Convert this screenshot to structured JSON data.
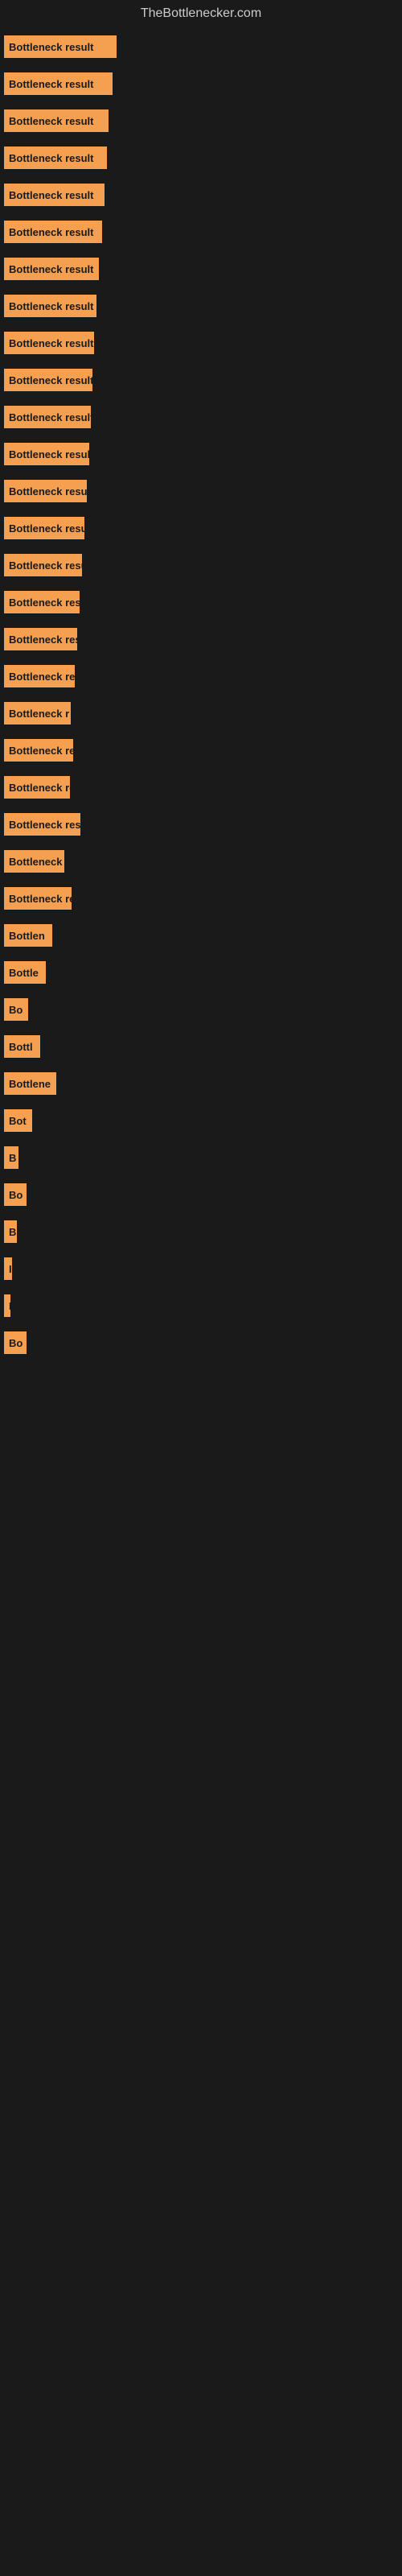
{
  "site": {
    "title": "TheBottlenecker.com"
  },
  "bars": [
    {
      "label": "Bottleneck result",
      "width": 140
    },
    {
      "label": "Bottleneck result",
      "width": 135
    },
    {
      "label": "Bottleneck result",
      "width": 130
    },
    {
      "label": "Bottleneck result",
      "width": 128
    },
    {
      "label": "Bottleneck result",
      "width": 125
    },
    {
      "label": "Bottleneck result",
      "width": 122
    },
    {
      "label": "Bottleneck result",
      "width": 118
    },
    {
      "label": "Bottleneck result",
      "width": 115
    },
    {
      "label": "Bottleneck result",
      "width": 112
    },
    {
      "label": "Bottleneck result",
      "width": 110
    },
    {
      "label": "Bottleneck result",
      "width": 108
    },
    {
      "label": "Bottleneck result",
      "width": 106
    },
    {
      "label": "Bottleneck result",
      "width": 103
    },
    {
      "label": "Bottleneck result",
      "width": 100
    },
    {
      "label": "Bottleneck result",
      "width": 97
    },
    {
      "label": "Bottleneck result",
      "width": 94
    },
    {
      "label": "Bottleneck result",
      "width": 91
    },
    {
      "label": "Bottleneck resu",
      "width": 88
    },
    {
      "label": "Bottleneck r",
      "width": 83
    },
    {
      "label": "Bottleneck resu",
      "width": 86
    },
    {
      "label": "Bottleneck res",
      "width": 82
    },
    {
      "label": "Bottleneck result",
      "width": 95
    },
    {
      "label": "Bottleneck",
      "width": 75
    },
    {
      "label": "Bottleneck resu",
      "width": 84
    },
    {
      "label": "Bottlen",
      "width": 60
    },
    {
      "label": "Bottle",
      "width": 52
    },
    {
      "label": "Bo",
      "width": 30
    },
    {
      "label": "Bottl",
      "width": 45
    },
    {
      "label": "Bottlene",
      "width": 65
    },
    {
      "label": "Bot",
      "width": 35
    },
    {
      "label": "B",
      "width": 18
    },
    {
      "label": "Bo",
      "width": 28
    },
    {
      "label": "B",
      "width": 16
    },
    {
      "label": "I",
      "width": 10
    },
    {
      "label": "I",
      "width": 8
    },
    {
      "label": "Bo",
      "width": 28
    }
  ]
}
